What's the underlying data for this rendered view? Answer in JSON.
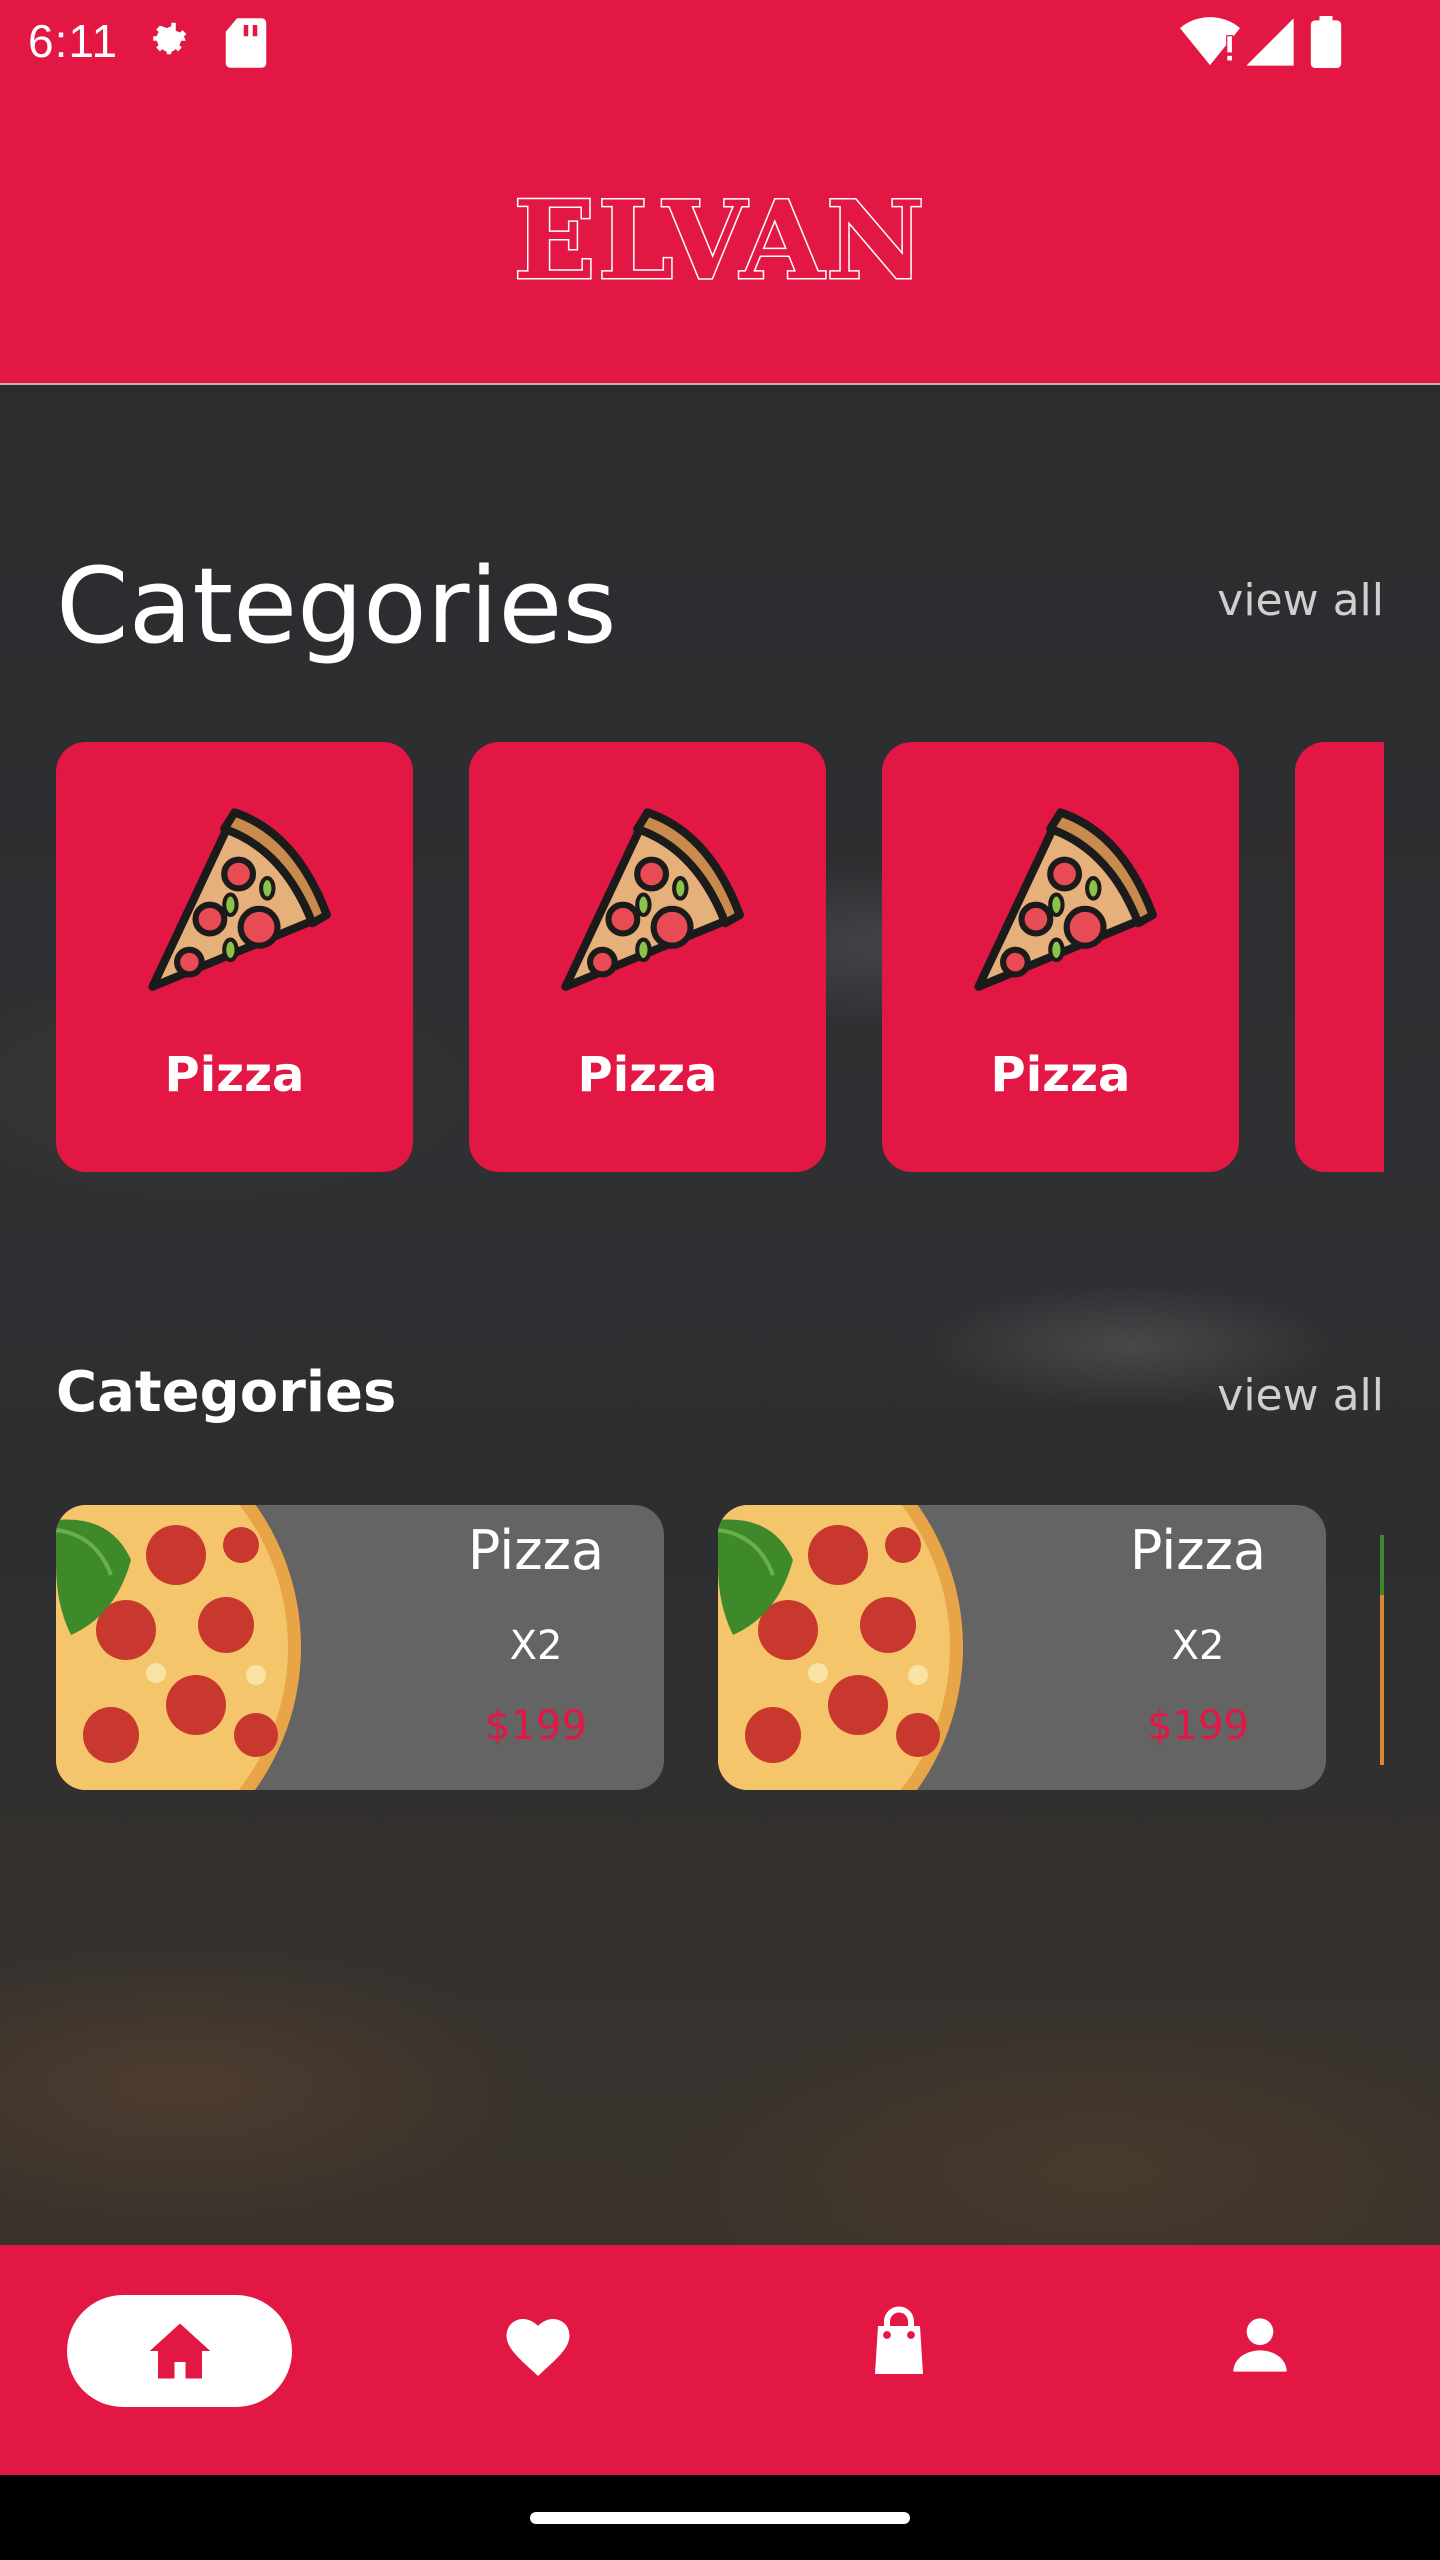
{
  "status_bar": {
    "time": "6:11",
    "icons": [
      "settings-gear-icon",
      "sd-card-icon",
      "wifi-icon",
      "cellular-signal-icon",
      "battery-icon"
    ]
  },
  "header": {
    "logo_text": "ELVAN"
  },
  "categories_section": {
    "title": "Categories",
    "view_all_label": "view all",
    "items": [
      {
        "label": "Pizza",
        "icon": "pizza-slice-icon"
      },
      {
        "label": "Pizza",
        "icon": "pizza-slice-icon"
      },
      {
        "label": "Pizza",
        "icon": "pizza-slice-icon"
      }
    ]
  },
  "products_section": {
    "title": "Categories",
    "view_all_label": "view all",
    "items": [
      {
        "name": "Pizza",
        "quantity": "X2",
        "price": "$199"
      },
      {
        "name": "Pizza",
        "quantity": "X2",
        "price": "$199"
      }
    ]
  },
  "bottom_nav": {
    "items": [
      {
        "name": "home",
        "icon": "home-icon",
        "active": true
      },
      {
        "name": "favorites",
        "icon": "heart-icon",
        "active": false
      },
      {
        "name": "cart",
        "icon": "shopping-bag-icon",
        "active": false
      },
      {
        "name": "profile",
        "icon": "person-icon",
        "active": false
      }
    ]
  },
  "colors": {
    "brand_red": "#e31743",
    "card_gray": "#646464",
    "view_all_gray": "#cfcfcf"
  }
}
